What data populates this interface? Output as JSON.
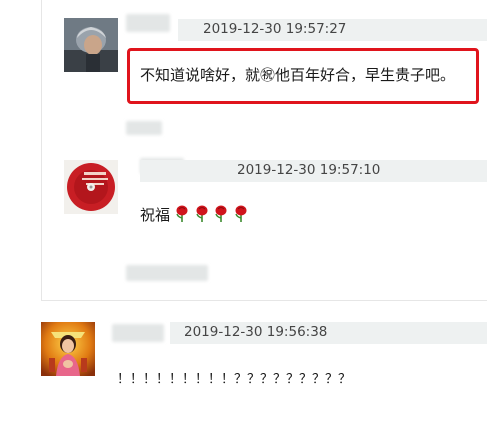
{
  "comments": [
    {
      "timestamp": "2019-12-30 19:57:27",
      "text": "不知道说啥好，就㊗他百年好合，早生贵子吧。",
      "highlighted": true
    },
    {
      "timestamp": "2019-12-30 19:57:10",
      "text": "祝福",
      "emoji_icons": [
        "rose-icon",
        "rose-icon",
        "rose-icon",
        "rose-icon"
      ]
    },
    {
      "timestamp": "2019-12-30 19:56:38",
      "text": "！！！！！！！！！？？？？？？？？？"
    }
  ],
  "colors": {
    "highlight_border": "#e0141c",
    "meta_bar": "#eef1f1",
    "divider": "#e6e6e6"
  }
}
